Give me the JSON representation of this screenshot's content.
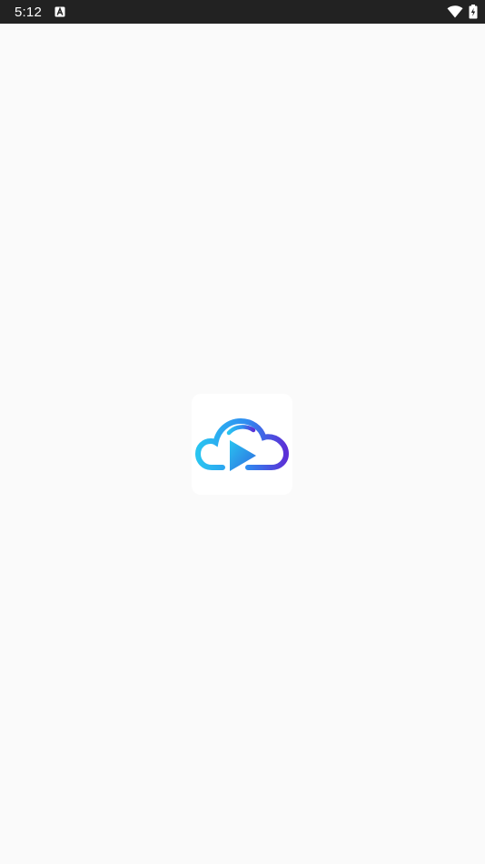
{
  "status_bar": {
    "time": "5:12",
    "icons": [
      "notification-a-icon",
      "wifi-icon",
      "battery-charging-icon"
    ]
  },
  "splash": {
    "logo": "cloud-play-icon",
    "colors": {
      "gradient_start": "#29c4f0",
      "gradient_mid": "#2f8cf0",
      "gradient_end": "#5b2fd6"
    }
  }
}
